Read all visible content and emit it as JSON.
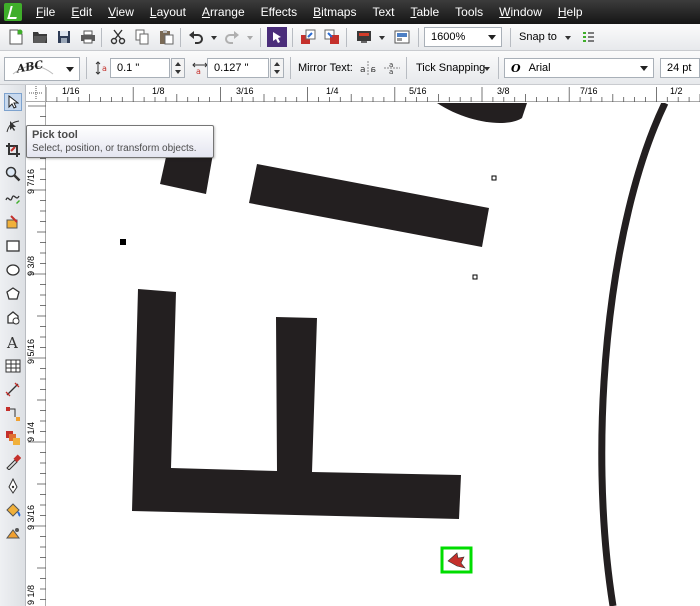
{
  "menu": {
    "items": [
      {
        "label": "File",
        "ul": "F",
        "rest": "ile"
      },
      {
        "label": "Edit",
        "ul": "E",
        "rest": "dit"
      },
      {
        "label": "View",
        "ul": "V",
        "rest": "iew"
      },
      {
        "label": "Layout",
        "ul": "L",
        "rest": "ayout"
      },
      {
        "label": "Arrange",
        "ul": "A",
        "rest": "rrange"
      },
      {
        "label": "Effects",
        "ul": "",
        "rest": "Effects"
      },
      {
        "label": "Bitmaps",
        "ul": "B",
        "rest": "itmaps"
      },
      {
        "label": "Text",
        "ul": "",
        "rest": "Text"
      },
      {
        "label": "Table",
        "ul": "T",
        "rest": "able"
      },
      {
        "label": "Tools",
        "ul": "",
        "rest": "Tools"
      },
      {
        "label": "Window",
        "ul": "W",
        "rest": "indow"
      },
      {
        "label": "Help",
        "ul": "H",
        "rest": "elp"
      }
    ]
  },
  "toolbar1": {
    "zoom_level": "1600%",
    "snap_label": "Snap to"
  },
  "toolbar2": {
    "fit_text_label": "ABC",
    "offset_value": "0.1 \"",
    "spacing_value": "0.127 \"",
    "mirror_label": "Mirror Text:",
    "tick_snapping_label": "Tick Snapping",
    "font_name": "Arial",
    "font_size": "24 pt"
  },
  "ruler_top": {
    "labels": [
      "1/16",
      "1/8",
      "3/16",
      "1/4",
      "5/16",
      "3/8",
      "7/16",
      "1/2"
    ]
  },
  "ruler_left": {
    "labels": [
      "9 7/16",
      "9 3/8",
      "9 5/16",
      "9 1/4",
      "9 3/16",
      "9 1/8"
    ]
  },
  "tooltip": {
    "title": "Pick tool",
    "description": "Select, position, or transform objects."
  },
  "colors": {
    "menubar": "#1e1e1e",
    "shape_fill": "#231f20",
    "highlight_box": "#00dd00",
    "app_accent": "#3fae2a"
  }
}
